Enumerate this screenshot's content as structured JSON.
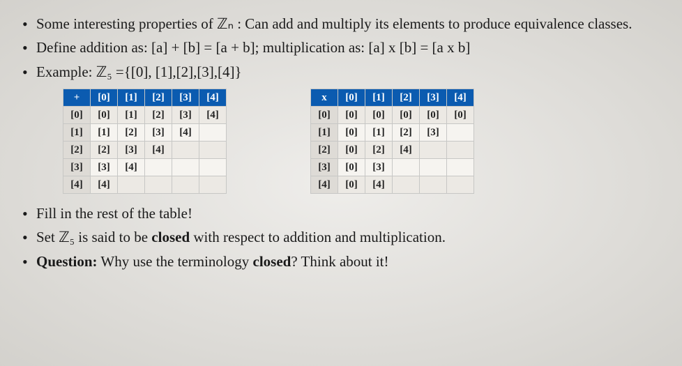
{
  "bullets_top": [
    "Some interesting properties of ℤₙ : Can add and multiply its elements to produce equivalence classes.",
    "Define addition as: [a] + [b] = [a + b]; multiplication as: [a] x [b] = [a x b]",
    "Example: ℤ₅ ={[0], [1],[2],[3],[4]}"
  ],
  "bullets_bottom": [
    {
      "text": "Fill in the rest of the table!",
      "bold_parts": []
    },
    {
      "prefix": "Set ℤ₅ is said to be ",
      "bold": "closed",
      "suffix": " with respect to addition and multiplication."
    },
    {
      "prefix_bold": "Question:",
      "rest": " Why use the terminology ",
      "bold2": "closed",
      "suffix": "? Think about it!"
    }
  ],
  "add_table": {
    "op": "+",
    "headers": [
      "[0]",
      "[1]",
      "[2]",
      "[3]",
      "[4]"
    ],
    "rows": [
      {
        "head": "[0]",
        "cells": [
          "[0]",
          "[1]",
          "[2]",
          "[3]",
          "[4]"
        ]
      },
      {
        "head": "[1]",
        "cells": [
          "[1]",
          "[2]",
          "[3]",
          "[4]",
          ""
        ]
      },
      {
        "head": "[2]",
        "cells": [
          "[2]",
          "[3]",
          "[4]",
          "",
          ""
        ]
      },
      {
        "head": "[3]",
        "cells": [
          "[3]",
          "[4]",
          "",
          "",
          ""
        ]
      },
      {
        "head": "[4]",
        "cells": [
          "[4]",
          "",
          "",
          "",
          ""
        ]
      }
    ]
  },
  "mul_table": {
    "op": "x",
    "headers": [
      "[0]",
      "[1]",
      "[2]",
      "[3]",
      "[4]"
    ],
    "rows": [
      {
        "head": "[0]",
        "cells": [
          "[0]",
          "[0]",
          "[0]",
          "[0]",
          "[0]"
        ]
      },
      {
        "head": "[1]",
        "cells": [
          "[0]",
          "[1]",
          "[2]",
          "[3]",
          ""
        ]
      },
      {
        "head": "[2]",
        "cells": [
          "[0]",
          "[2]",
          "[4]",
          "",
          ""
        ]
      },
      {
        "head": "[3]",
        "cells": [
          "[0]",
          "[3]",
          "",
          "",
          ""
        ]
      },
      {
        "head": "[4]",
        "cells": [
          "[0]",
          "[4]",
          "",
          "",
          ""
        ]
      }
    ]
  }
}
